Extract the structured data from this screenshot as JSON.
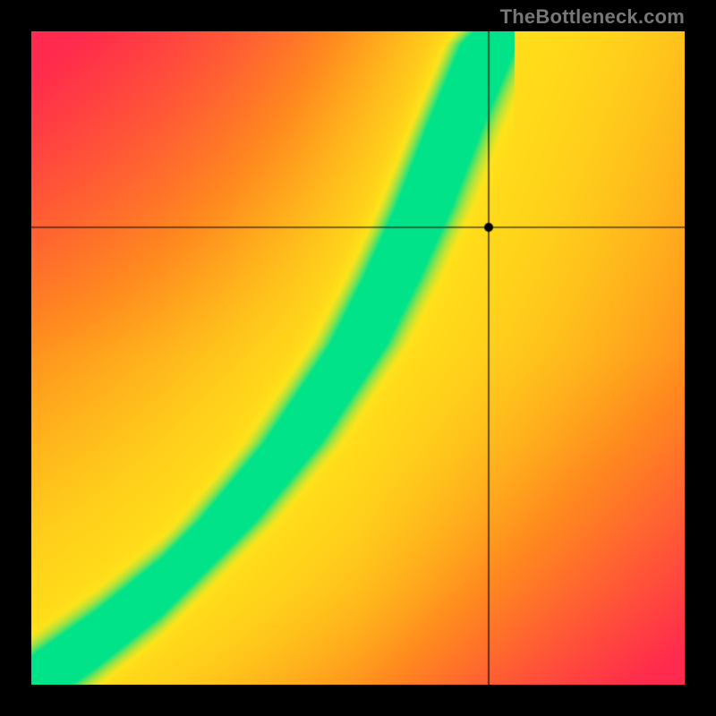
{
  "watermark": "TheBottleneck.com",
  "chart_data": {
    "type": "heatmap",
    "title": "",
    "xlabel": "",
    "ylabel": "",
    "xlim": [
      0,
      1
    ],
    "ylim": [
      0,
      1
    ],
    "marker": {
      "x": 0.7,
      "y": 0.7,
      "radius": 5
    },
    "crosshair": {
      "x": 0.7,
      "y": 0.7
    },
    "ideal_curve": {
      "comment": "approximate ridge y(x) of the green band, normalized 0..1",
      "x": [
        0.0,
        0.1,
        0.2,
        0.3,
        0.4,
        0.5,
        0.55,
        0.6,
        0.65,
        0.7,
        0.72
      ],
      "y": [
        0.0,
        0.07,
        0.15,
        0.25,
        0.37,
        0.52,
        0.62,
        0.73,
        0.86,
        0.98,
        1.0
      ]
    },
    "secondary_ridge": {
      "comment": "yellow diagonal toward top-right (approx y = x)",
      "x": [
        0.0,
        1.0
      ],
      "y": [
        0.0,
        1.0
      ]
    },
    "band_width": 0.045,
    "colors": {
      "cold": "#ff2a4d",
      "warm": "#ff8a1f",
      "hot": "#ffe31a",
      "peak": "#00e38a"
    }
  }
}
